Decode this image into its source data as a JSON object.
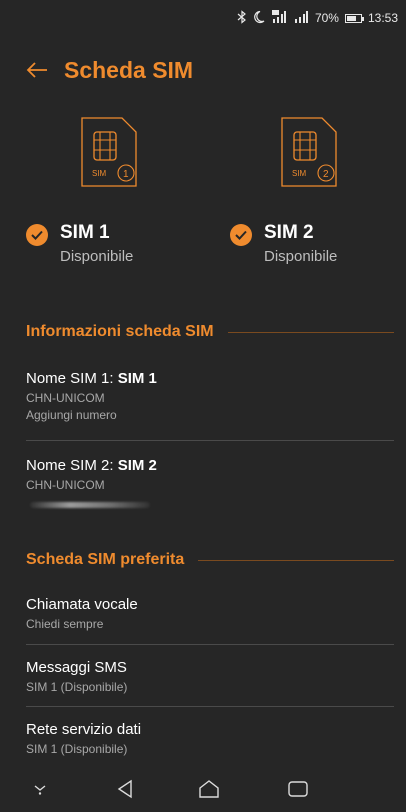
{
  "status_bar": {
    "battery": "70%",
    "battery_level": 0.7,
    "time": "13:53",
    "icons": [
      "bluetooth-icon",
      "moon-icon",
      "signal-icon",
      "signal-icon",
      "battery-icon"
    ]
  },
  "header": {
    "title": "Scheda SIM",
    "back_icon": "back-arrow-icon"
  },
  "sims": [
    {
      "name": "SIM 1",
      "status": "Disponibile",
      "icon_label": "SIM",
      "icon_number": "1",
      "checked": true
    },
    {
      "name": "SIM 2",
      "status": "Disponibile",
      "icon_label": "SIM",
      "icon_number": "2",
      "checked": true
    }
  ],
  "info_section": {
    "title": "Informazioni scheda SIM",
    "items": [
      {
        "label_prefix": "Nome SIM 1: ",
        "label_value": "SIM 1",
        "carrier": "CHN-UNICOM",
        "extra": "Aggiungi numero"
      },
      {
        "label_prefix": "Nome SIM 2: ",
        "label_value": "SIM 2",
        "carrier": "CHN-UNICOM",
        "extra": ""
      }
    ]
  },
  "preferred_section": {
    "title": "Scheda SIM preferita",
    "items": [
      {
        "title": "Chiamata vocale",
        "subtitle": "Chiedi sempre"
      },
      {
        "title": "Messaggi SMS",
        "subtitle": "SIM 1 (Disponibile)"
      },
      {
        "title": "Rete servizio dati",
        "subtitle": "SIM 1 (Disponibile)"
      }
    ]
  },
  "nav_bar": {
    "buttons": [
      "hide-nav-icon",
      "back-icon",
      "home-icon",
      "recents-icon"
    ]
  },
  "colors": {
    "accent": "#ef8b2e",
    "background": "#262626",
    "divider": "#4a4a4a"
  }
}
